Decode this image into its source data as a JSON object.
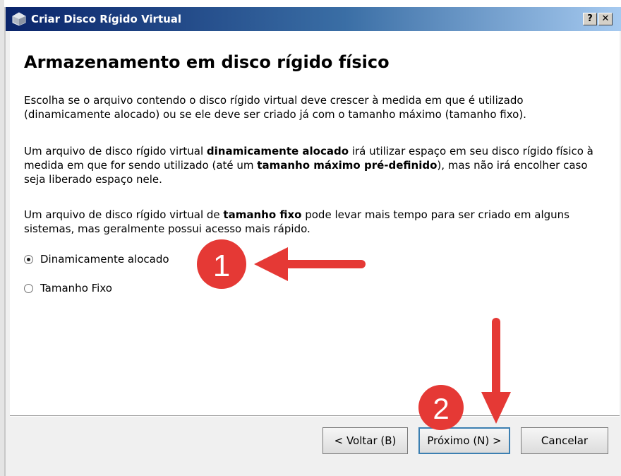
{
  "window": {
    "title": "Criar Disco Rígido Virtual",
    "help_button": "?",
    "close_button": "✕"
  },
  "page": {
    "heading": "Armazenamento em disco rígido físico",
    "para1": "Escolha se o arquivo contendo o disco rígido virtual deve crescer à medida em que é utilizado (dinamicamente alocado) ou se ele deve ser criado já com o tamanho máximo (tamanho fixo).",
    "para2": {
      "a": "Um arquivo de disco rígido virtual ",
      "b": "dinamicamente alocado",
      "c": " irá utilizar espaço em seu disco rígido físico à medida em que for sendo utilizado (até um ",
      "d": "tamanho máximo pré-definido",
      "e": "), mas não irá encolher caso seja liberado espaço nele."
    },
    "para3": {
      "a": "Um arquivo de disco rígido virtual de ",
      "b": "tamanho fixo",
      "c": " pode levar mais tempo para ser criado em alguns sistemas, mas geralmente possui acesso mais rápido."
    },
    "options": [
      {
        "label": "Dinamicamente alocado",
        "checked": true
      },
      {
        "label": "Tamanho Fixo",
        "checked": false
      }
    ]
  },
  "buttons": {
    "back": "< Voltar (B)",
    "next": "Próximo (N) >",
    "cancel": "Cancelar"
  },
  "annotations": {
    "marker1": "1",
    "marker2": "2",
    "color": "#e53935"
  },
  "icons": {
    "app": "virtualbox-icon",
    "help": "help-icon",
    "close": "close-icon"
  }
}
